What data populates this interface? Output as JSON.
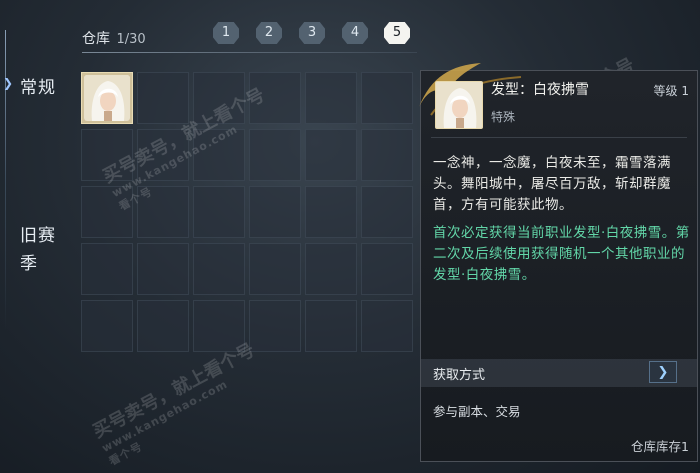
{
  "sidebar": {
    "tabs": [
      {
        "label": "常规",
        "active": true
      },
      {
        "label": "旧赛季",
        "active": false
      }
    ]
  },
  "warehouse": {
    "title": "仓库",
    "count": "1/30",
    "pages": [
      "1",
      "2",
      "3",
      "4",
      "5"
    ],
    "active_page": "5"
  },
  "grid": {
    "rows": 5,
    "cols": 6,
    "items": [
      {
        "slot": 0,
        "name": "发型：白夜拂雪",
        "icon": "character-portrait"
      }
    ]
  },
  "tooltip": {
    "item_name": "发型：白夜拂雪",
    "level": "等级 1",
    "type": "特殊",
    "description": "一念神，一念魔，白夜未至，霜雪落满头。舞阳城中，屠尽百万敌，斩却群魔首，方有可能获此物。",
    "note": "首次必定获得当前职业发型·白夜拂雪。第二次及后续使用获得随机一个其他职业的发型·白夜拂雪。",
    "source_label": "获取方式",
    "source_text": "参与副本、交易",
    "footer": "仓库库存1",
    "colors": {
      "note_green": "#62d6a8",
      "gold_frame": "#c9a24a"
    }
  },
  "watermarks": [
    {
      "line": "买号卖号，就上看个号",
      "url": "www.kangehao.com",
      "tag": "看个号"
    },
    {
      "line": "买号卖号，就上看个号",
      "url": "www.kangehao.com",
      "tag": "看个号"
    },
    {
      "line": "买号卖号，就上看个号",
      "url": "www.kangehao.com",
      "tag": "看个号"
    },
    {
      "line": "买号卖号，就上看个号",
      "url": "www.kangehao.com",
      "tag": "看个号"
    }
  ]
}
